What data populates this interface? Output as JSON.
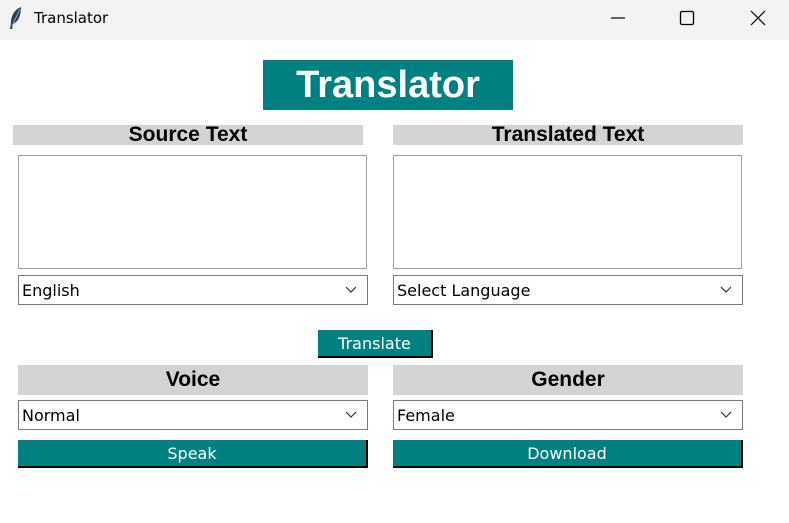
{
  "window": {
    "title": "Translator",
    "icon": "feather-icon",
    "controls": [
      "minimize-icon",
      "maximize-icon",
      "close-icon"
    ]
  },
  "heading": "Translator",
  "source": {
    "label": "Source Text",
    "text": "",
    "language": "English"
  },
  "translated": {
    "label": "Translated Text",
    "text": "",
    "language": "Select Language"
  },
  "translate_button": "Translate",
  "voice": {
    "label": "Voice",
    "selected": "Normal"
  },
  "gender": {
    "label": "Gender",
    "selected": "Female"
  },
  "speak_button": "Speak",
  "download_button": "Download",
  "colors": {
    "accent": "#008080",
    "label_bg": "#d3d3d3",
    "titlebar_bg": "#f3f3f3"
  }
}
